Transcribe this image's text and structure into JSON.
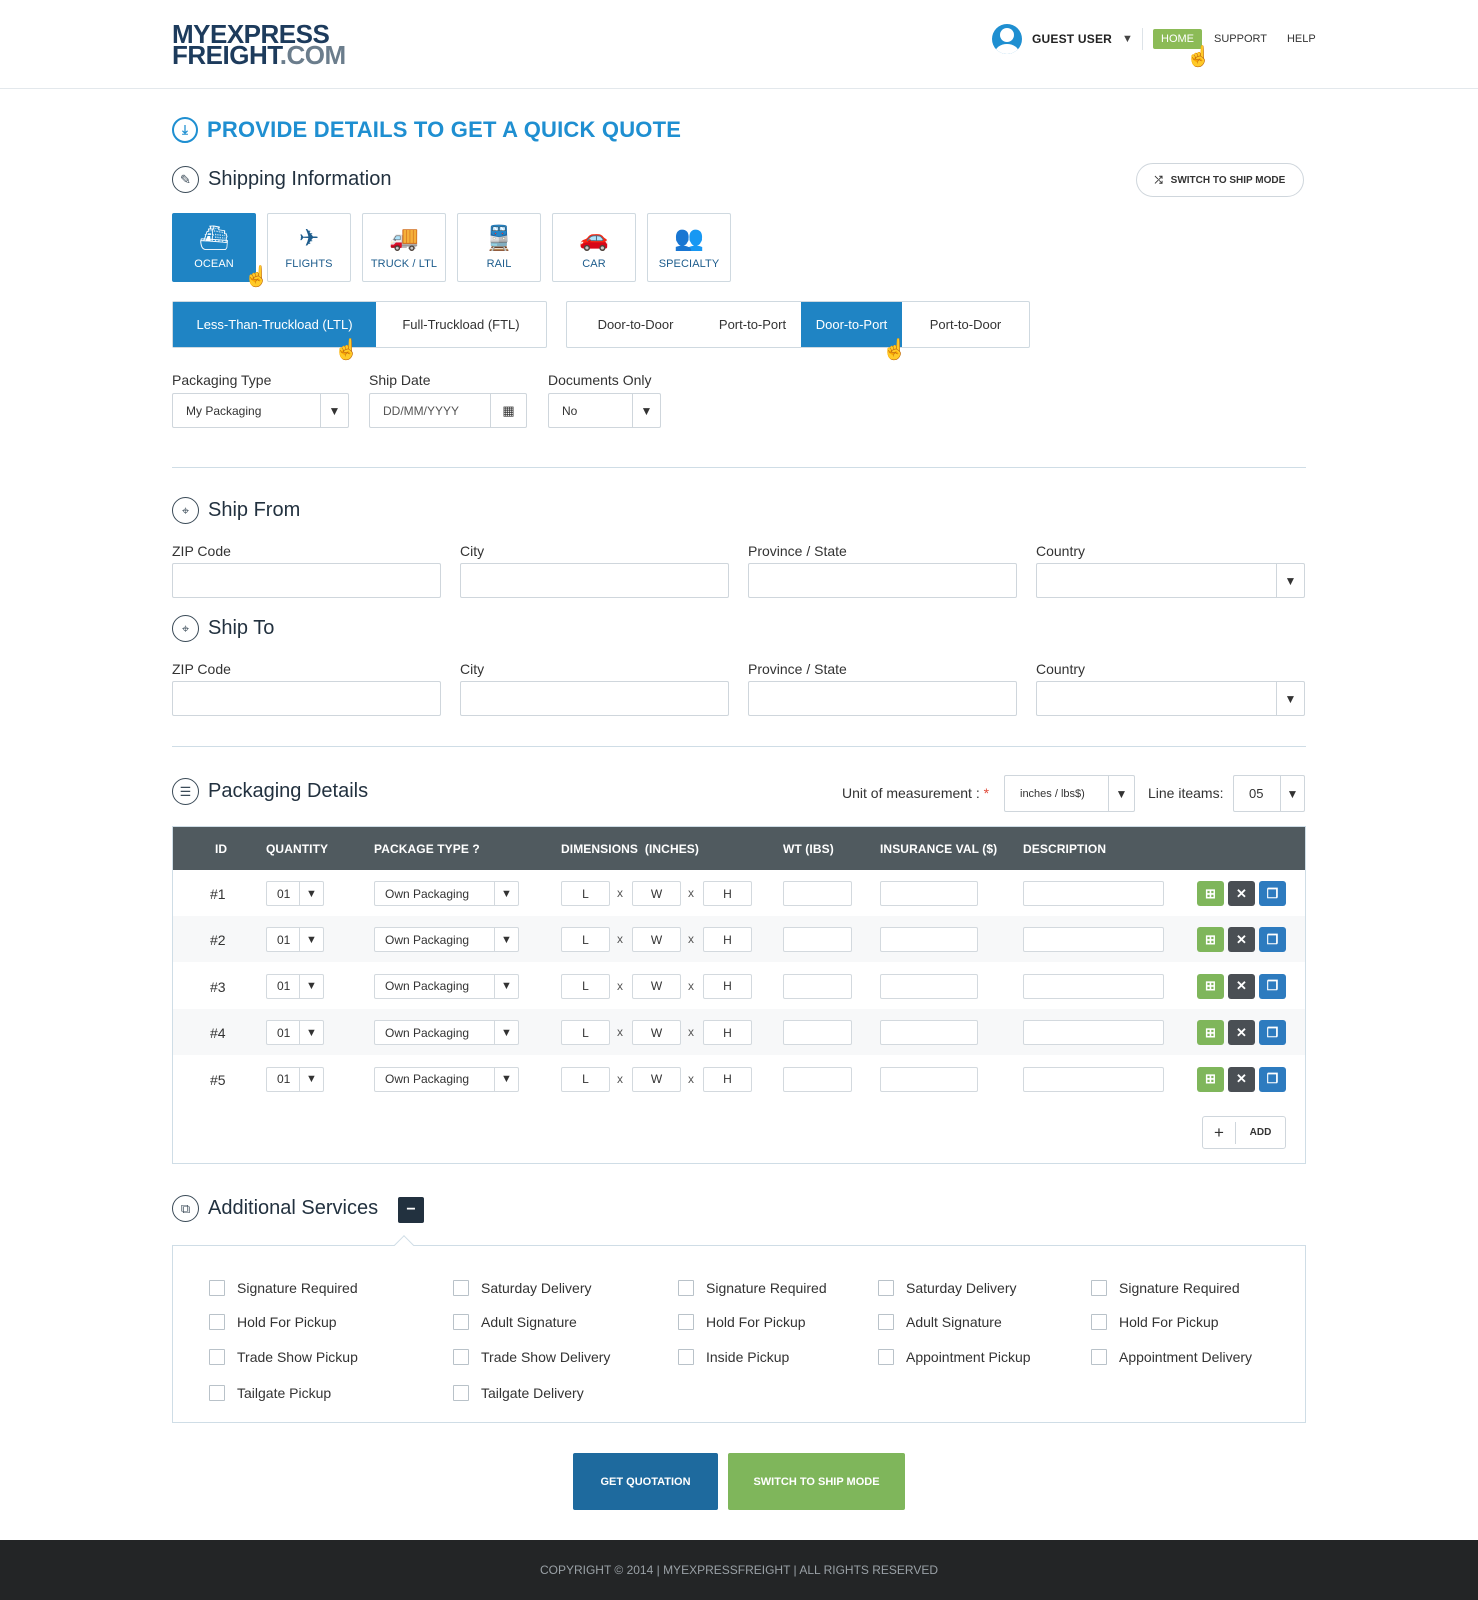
{
  "header": {
    "logo_line1": "MYEXPRESS",
    "logo_line2_main": "FREIGHT",
    "logo_line2_suffix": ".COM",
    "user_name": "GUEST USER",
    "nav": [
      "HOME",
      "SUPPORT",
      "HELP"
    ],
    "active_nav": "HOME"
  },
  "page_title": "PROVIDE DETAILS TO GET A QUICK QUOTE",
  "shipping": {
    "title": "Shipping Information",
    "switch_label": "SWITCH TO SHIP MODE",
    "modes": [
      {
        "label": "OCEAN",
        "icon": "ship-icon",
        "glyph": "⛴",
        "active": true
      },
      {
        "label": "FLIGHTS",
        "icon": "plane-icon",
        "glyph": "✈",
        "active": false
      },
      {
        "label": "TRUCK / LTL",
        "icon": "truck-icon",
        "glyph": "🚚",
        "active": false
      },
      {
        "label": "RAIL",
        "icon": "train-icon",
        "glyph": "🚆",
        "active": false
      },
      {
        "label": "CAR",
        "icon": "car-icon",
        "glyph": "🚗",
        "active": false
      },
      {
        "label": "SPECIALTY",
        "icon": "specialty-icon",
        "glyph": "👥",
        "active": false
      }
    ],
    "load_types": [
      "Less-Than-Truckload (LTL)",
      "Full-Truckload (FTL)"
    ],
    "active_load": "Less-Than-Truckload (LTL)",
    "routes": [
      "Door-to-Door",
      "Port-to-Port",
      "Door-to-Port",
      "Port-to-Door"
    ],
    "active_route": "Door-to-Port",
    "packaging_type_label": "Packaging Type",
    "packaging_type_value": "My Packaging",
    "ship_date_label": "Ship Date",
    "ship_date_placeholder": "DD/MM/YYYY",
    "documents_only_label": "Documents Only",
    "documents_only_value": "No"
  },
  "ship_from": {
    "title": "Ship From",
    "zip_label": "ZIP Code",
    "city_label": "City",
    "state_label": "Province / State",
    "country_label": "Country"
  },
  "ship_to": {
    "title": "Ship To",
    "zip_label": "ZIP Code",
    "city_label": "City",
    "state_label": "Province / State",
    "country_label": "Country"
  },
  "packaging": {
    "title": "Packaging Details",
    "unit_label": "Unit of measurement :",
    "required_mark": "*",
    "unit_value": "inches / lbs$)",
    "line_items_label": "Line iteams:",
    "line_items_value": "05",
    "columns": [
      "ID",
      "QUANTITY",
      "PACKAGE TYPE ?",
      "DIMENSIONS  (INCHES)",
      "WT (IBS)",
      "INSURANCE VAL ($)",
      "DESCRIPTION"
    ],
    "rows": [
      {
        "id": "#1",
        "qty": "01",
        "type": "Own Packaging",
        "l": "L",
        "w": "W",
        "h": "H",
        "x": "x"
      },
      {
        "id": "#2",
        "qty": "01",
        "type": "Own Packaging",
        "l": "L",
        "w": "W",
        "h": "H",
        "x": "x"
      },
      {
        "id": "#3",
        "qty": "01",
        "type": "Own Packaging",
        "l": "L",
        "w": "W",
        "h": "H",
        "x": "x"
      },
      {
        "id": "#4",
        "qty": "01",
        "type": "Own Packaging",
        "l": "L",
        "w": "W",
        "h": "H",
        "x": "x"
      },
      {
        "id": "#5",
        "qty": "01",
        "type": "Own Packaging",
        "l": "L",
        "w": "W",
        "h": "H",
        "x": "x"
      }
    ],
    "add_label": "ADD"
  },
  "additional": {
    "title": "Additional Services",
    "columns": [
      [
        "Signature Required",
        "Hold For Pickup",
        "Trade Show Pickup",
        "Tailgate Pickup"
      ],
      [
        "Saturday Delivery",
        "Adult Signature",
        "Trade Show Delivery",
        "Tailgate Delivery"
      ],
      [
        "Signature Required",
        "Hold For Pickup",
        "Inside Pickup"
      ],
      [
        "Saturday Delivery",
        "Adult Signature",
        "Appointment Pickup"
      ],
      [
        "Signature Required",
        "Hold For Pickup",
        "Appointment Delivery"
      ]
    ]
  },
  "actions": {
    "quote": "GET QUOTATION",
    "ship": "SWITCH TO SHIP MODE"
  },
  "footer": "COPYRIGHT © 2014 | MYEXPRESSFREIGHT | ALL RIGHTS RESERVED"
}
